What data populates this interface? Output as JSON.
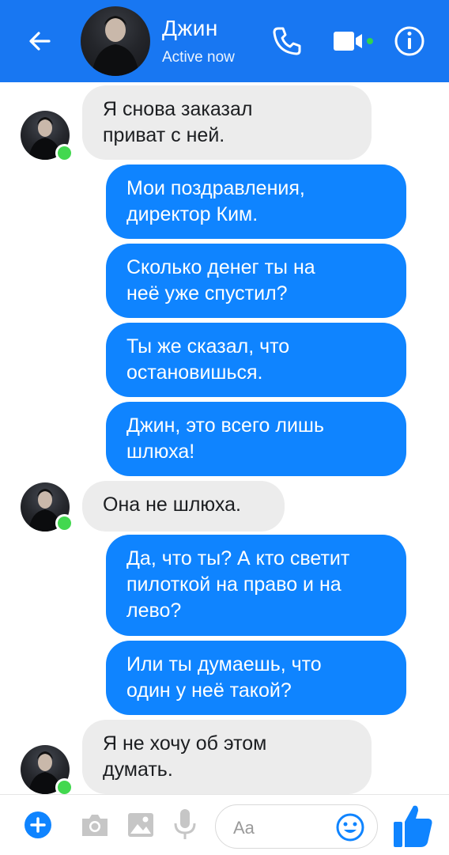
{
  "header": {
    "contact_name": "Джин",
    "status": "Active now",
    "icons": {
      "back": "arrow-left-icon",
      "call": "phone-icon",
      "video": "video-camera-icon",
      "info": "info-icon"
    }
  },
  "messages": [
    {
      "direction": "in",
      "text": "Я снова заказал\nприват с ней."
    },
    {
      "direction": "out",
      "text": "Мои поздравления,\nдиректор Ким."
    },
    {
      "direction": "out",
      "text": "Сколько денег ты на\nнеё уже спустил?"
    },
    {
      "direction": "out",
      "text": "Ты же сказал, что\nостановишься."
    },
    {
      "direction": "out",
      "text": "Джин, это всего лишь\nшлюха!"
    },
    {
      "direction": "in",
      "text": "Она не шлюха."
    },
    {
      "direction": "out",
      "text": "Да, что ты? А кто светит\nпилоткой на право и на\nлево?"
    },
    {
      "direction": "out",
      "text": "Или ты думаешь, что\nодин у неё такой?"
    },
    {
      "direction": "in",
      "text": "Я не хочу об этом\nдумать."
    }
  ],
  "composer": {
    "placeholder": "Aa",
    "icons": [
      "plus-icon",
      "camera-icon",
      "image-icon",
      "microphone-icon",
      "emoji-icon",
      "thumbs-up-icon"
    ]
  },
  "colors": {
    "brand_blue": "#1877f2",
    "outgoing_bubble": "#0f84ff",
    "incoming_bubble": "#ececec",
    "online_green": "#42d84f"
  }
}
